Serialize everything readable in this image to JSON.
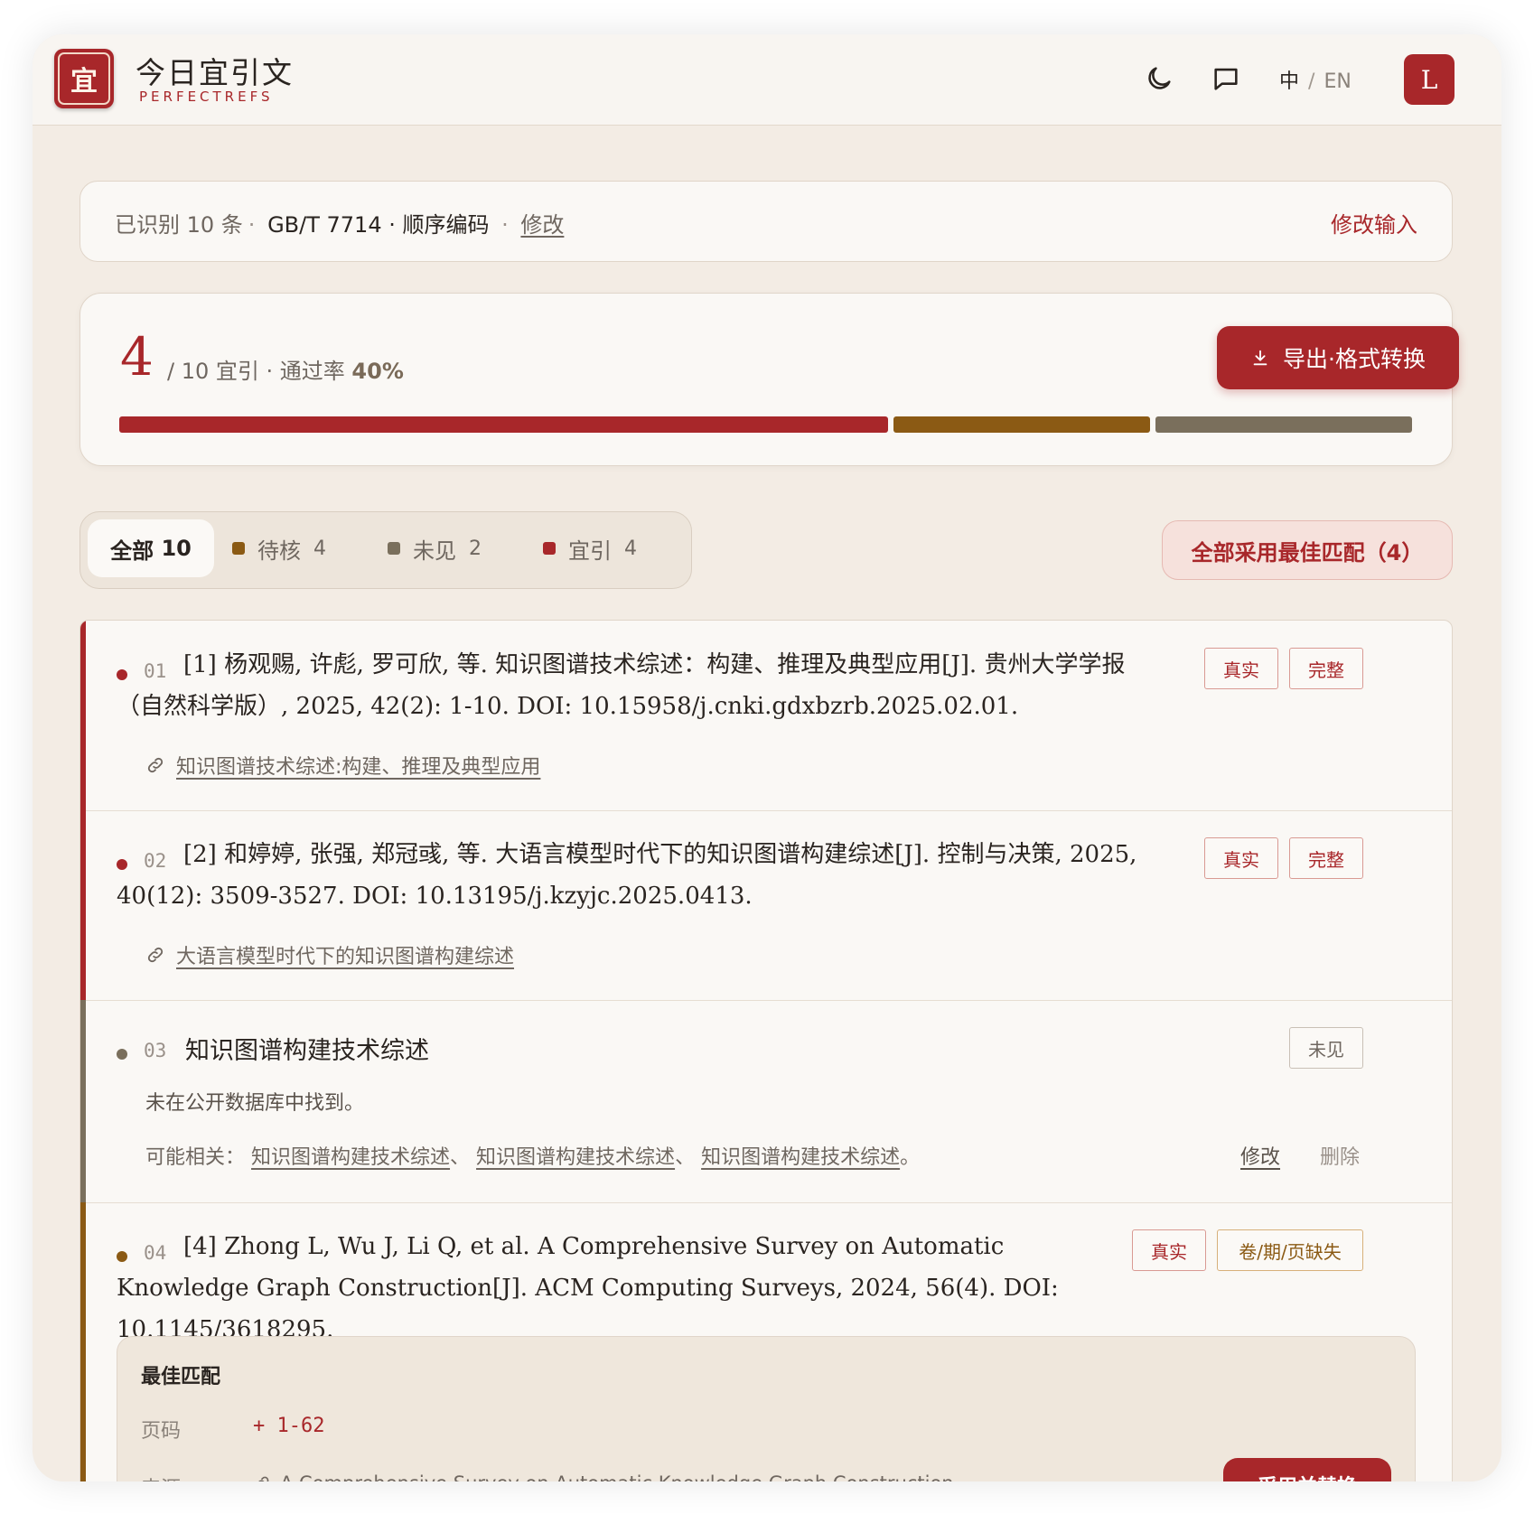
{
  "app": {
    "logo_glyph": "宜",
    "name": "今日宜引文",
    "subtitle": "PERFECTREFS",
    "lang_zh": "中",
    "lang_sep": "/",
    "lang_en": "EN",
    "avatar_initial": "L",
    "accent_color": "#a8272a"
  },
  "summary": {
    "recognized": "已识别 10 条",
    "dot": "·",
    "standard": "GB/T 7714 · 顺序编码",
    "edit_label": "修改",
    "modify_input_label": "修改输入"
  },
  "stats": {
    "passed": "4",
    "total_text": "/ 10 宜引 · 通过率",
    "rate": "40%",
    "export_label": "导出·格式转换",
    "bar_segments": [
      {
        "status": "宜引",
        "fraction": 0.6,
        "color": "#a8272a"
      },
      {
        "status": "待核",
        "fraction": 0.2,
        "color": "#8b5a14"
      },
      {
        "status": "未见",
        "fraction": 0.2,
        "color": "#7a6f5c"
      }
    ]
  },
  "filters": {
    "all_label": "全部",
    "all_count": "10",
    "pending_label": "待核",
    "pending_count": "4",
    "pending_color": "#8b5a14",
    "unseen_label": "未见",
    "unseen_count": "2",
    "unseen_color": "#7a6f5c",
    "cite_label": "宜引",
    "cite_count": "4",
    "cite_color": "#a8272a",
    "adopt_all_label": "全部采用最佳匹配（4）"
  },
  "items": [
    {
      "num": "01",
      "text": "[1] 杨观赐, 许彪, 罗可欣, 等. 知识图谱技术综述：构建、推理及典型应用[J]. 贵州大学学报（自然科学版）, 2025, 42(2): 1-10. DOI: 10.15958/j.cnki.gdxbzrb.2025.02.01.",
      "badges": [
        "真实",
        "完整"
      ],
      "link": "知识图谱技术综述:构建、推理及典型应用"
    },
    {
      "num": "02",
      "text": "[2] 和婷婷, 张强, 郑冠彧, 等. 大语言模型时代下的知识图谱构建综述[J]. 控制与决策, 2025, 40(12): 3509-3527. DOI: 10.13195/j.kzyjc.2025.0413.",
      "badges": [
        "真实",
        "完整"
      ],
      "link": "大语言模型时代下的知识图谱构建综述"
    },
    {
      "num": "03",
      "text": "知识图谱构建技术综述",
      "badge": "未见",
      "note": "未在公开数据库中找到。",
      "related_label": "可能相关：",
      "related": [
        "知识图谱构建技术综述",
        "知识图谱构建技术综述",
        "知识图谱构建技术综述"
      ],
      "related_sep": "、",
      "related_end": "。",
      "edit_label": "修改",
      "delete_label": "删除"
    },
    {
      "num": "04",
      "text": "[4] Zhong L, Wu J, Li Q, et al. A Comprehensive Survey on Automatic Knowledge Graph Construction[J]. ACM Computing Surveys, 2024, 56(4). DOI: 10.1145/3618295.",
      "badges": [
        "真实",
        "卷/期/页缺失"
      ],
      "match": {
        "heading": "最佳匹配",
        "page_label": "页码",
        "page_value": "+ 1-62",
        "source_label": "来源",
        "source_value": "A Comprehensive Survey on Automatic Knowledge Graph Construction",
        "replace_label": "采用并替换"
      }
    }
  ]
}
